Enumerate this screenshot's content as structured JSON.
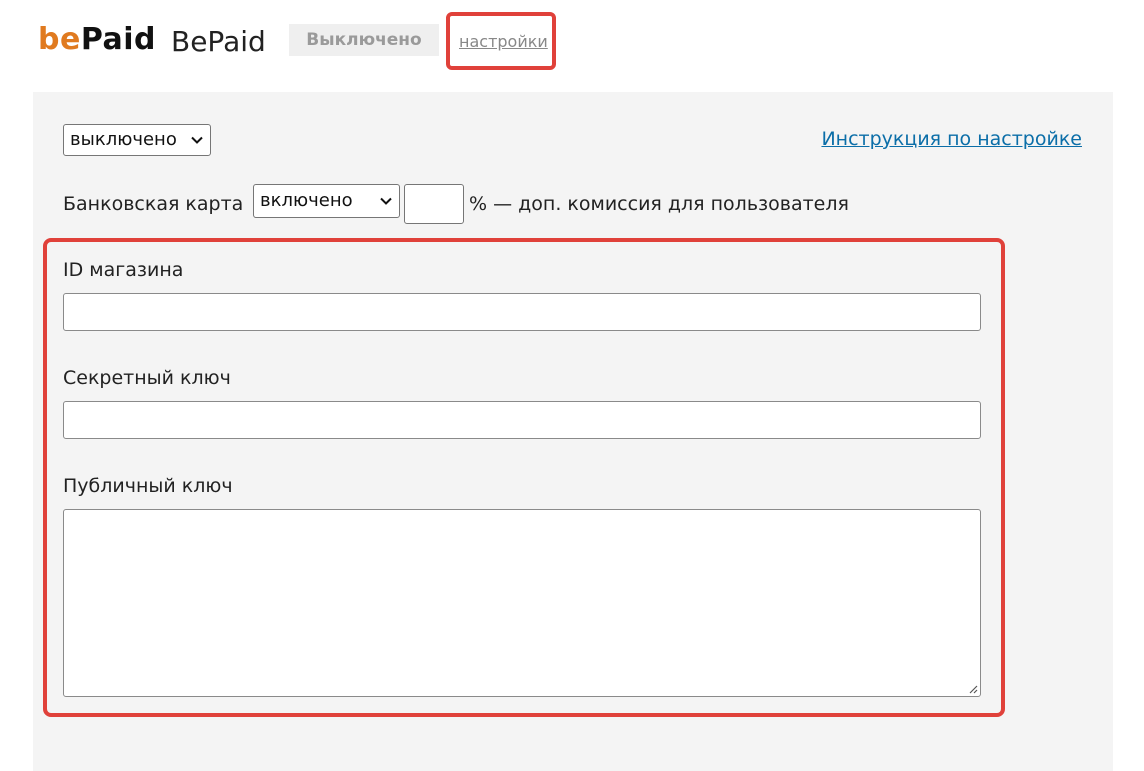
{
  "header": {
    "logo_be": "be",
    "logo_paid": "Paid",
    "app_name": "BePaid",
    "status": "Выключено",
    "settings_link": "настройки"
  },
  "panel": {
    "mode_select_value": "выключено",
    "instructions_link": "Инструкция по настройке",
    "bank_card": {
      "label": "Банковская карта",
      "select_value": "включено",
      "commission_value": "",
      "commission_suffix": "% — доп. комиссия для пользователя"
    },
    "fields": [
      {
        "label": "ID магазина",
        "value": ""
      },
      {
        "label": "Секретный ключ",
        "value": ""
      },
      {
        "label": "Публичный ключ",
        "value": ""
      }
    ]
  },
  "colors": {
    "brand_orange": "#e07a1f",
    "highlight_red": "#e0413a",
    "link_blue": "#0b6ea8",
    "panel_bg": "#f4f4f4"
  },
  "icons": [
    "chevron-down-icon",
    "resize-handle-icon"
  ]
}
